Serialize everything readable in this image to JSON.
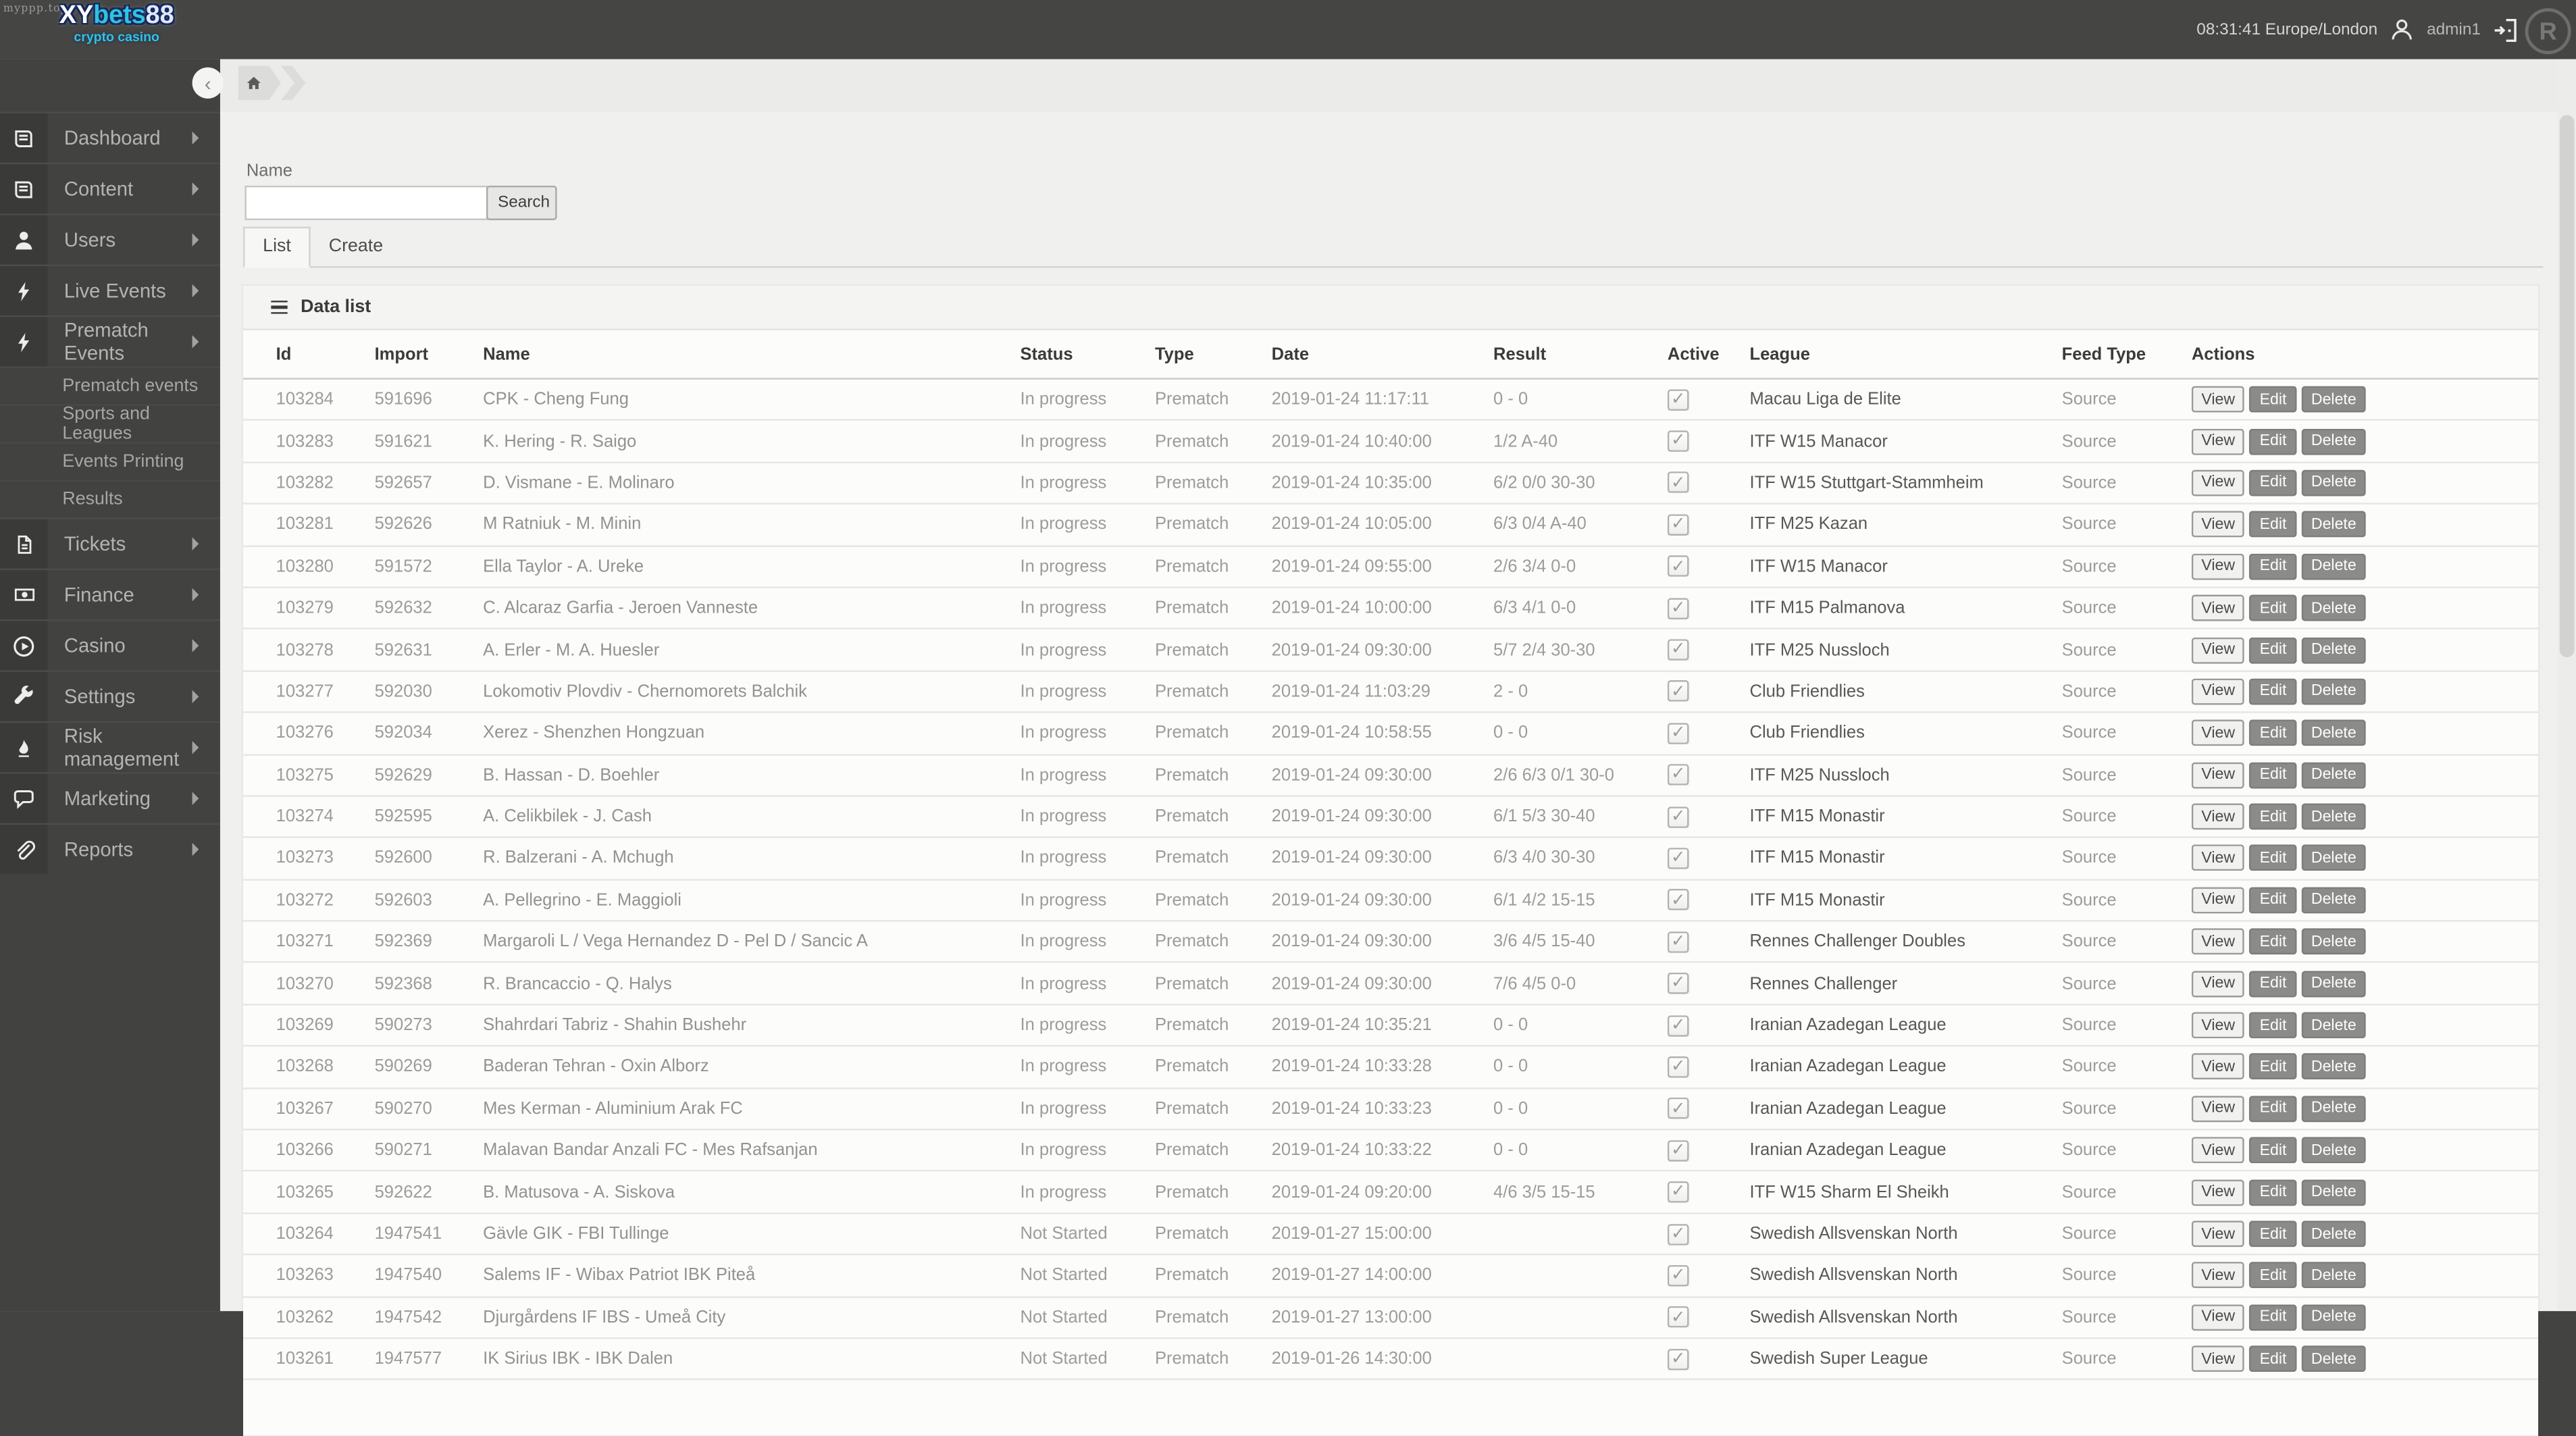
{
  "watermark": {
    "text": "myppp.top"
  },
  "brand": {
    "xy": "XY",
    "bets": "bets",
    "n88": "88",
    "subtitle": "crypto casino"
  },
  "topbar": {
    "clock": "08:31:41 Europe/London",
    "username": "admin1",
    "corner_badge": "R"
  },
  "colors": {
    "brand_cyan": "#2fc3e4",
    "sidebar_bg": "#424240",
    "topbar_bg": "#454543",
    "content_bg": "#f0f0ee",
    "button_dark": "#8b8b89",
    "accent_text": "#9c9c9a"
  },
  "sidebar": {
    "items": [
      {
        "type": "main",
        "icon": "book-icon",
        "label": "Dashboard"
      },
      {
        "type": "main",
        "icon": "book-icon",
        "label": "Content"
      },
      {
        "type": "main",
        "icon": "user-icon",
        "label": "Users"
      },
      {
        "type": "main",
        "icon": "bolt-icon",
        "label": "Live Events"
      },
      {
        "type": "main",
        "icon": "bolt-icon",
        "label": "Prematch Events"
      },
      {
        "type": "sub",
        "label": "Prematch events"
      },
      {
        "type": "sub",
        "label": "Sports and Leagues"
      },
      {
        "type": "sub",
        "label": "Events Printing"
      },
      {
        "type": "sub",
        "label": "Results"
      },
      {
        "type": "main",
        "icon": "file-icon",
        "label": "Tickets"
      },
      {
        "type": "main",
        "icon": "money-icon",
        "label": "Finance"
      },
      {
        "type": "main",
        "icon": "play-icon",
        "label": "Casino"
      },
      {
        "type": "main",
        "icon": "wrench-icon",
        "label": "Settings"
      },
      {
        "type": "main",
        "icon": "flame-icon",
        "label": "Risk management"
      },
      {
        "type": "main",
        "icon": "chat-icon",
        "label": "Marketing"
      },
      {
        "type": "main",
        "icon": "clip-icon",
        "label": "Reports"
      }
    ]
  },
  "filters": {
    "name_label": "Name",
    "name_value": "",
    "search_label": "Search"
  },
  "tabs": {
    "list": "List",
    "create": "Create"
  },
  "panel": {
    "title": "Data list"
  },
  "table": {
    "columns": [
      "Id",
      "Import",
      "Name",
      "Status",
      "Type",
      "Date",
      "Result",
      "Active",
      "League",
      "Feed Type",
      "Actions"
    ],
    "actions": [
      "View",
      "Edit",
      "Delete"
    ],
    "check_glyph": "✓",
    "rows": [
      {
        "id": "103284",
        "import": "591696",
        "name": "CPK - Cheng Fung",
        "status": "In progress",
        "type": "Prematch",
        "date": "2019-01-24 11:17:11",
        "result": "0 - 0",
        "active": true,
        "league": "Macau Liga de Elite",
        "feed": "Source"
      },
      {
        "id": "103283",
        "import": "591621",
        "name": "K. Hering - R. Saigo",
        "status": "In progress",
        "type": "Prematch",
        "date": "2019-01-24 10:40:00",
        "result": "1/2 A-40",
        "active": true,
        "league": "ITF W15 Manacor",
        "feed": "Source"
      },
      {
        "id": "103282",
        "import": "592657",
        "name": "D. Vismane - E. Molinaro",
        "status": "In progress",
        "type": "Prematch",
        "date": "2019-01-24 10:35:00",
        "result": "6/2 0/0 30-30",
        "active": true,
        "league": "ITF W15 Stuttgart-Stammheim",
        "feed": "Source"
      },
      {
        "id": "103281",
        "import": "592626",
        "name": "M Ratniuk - M. Minin",
        "status": "In progress",
        "type": "Prematch",
        "date": "2019-01-24 10:05:00",
        "result": "6/3 0/4 A-40",
        "active": true,
        "league": "ITF M25 Kazan",
        "feed": "Source"
      },
      {
        "id": "103280",
        "import": "591572",
        "name": "Ella Taylor - A. Ureke",
        "status": "In progress",
        "type": "Prematch",
        "date": "2019-01-24 09:55:00",
        "result": "2/6 3/4 0-0",
        "active": true,
        "league": "ITF W15 Manacor",
        "feed": "Source"
      },
      {
        "id": "103279",
        "import": "592632",
        "name": "C. Alcaraz Garfia - Jeroen Vanneste",
        "status": "In progress",
        "type": "Prematch",
        "date": "2019-01-24 10:00:00",
        "result": "6/3 4/1 0-0",
        "active": true,
        "league": "ITF M15 Palmanova",
        "feed": "Source"
      },
      {
        "id": "103278",
        "import": "592631",
        "name": "A. Erler - M. A. Huesler",
        "status": "In progress",
        "type": "Prematch",
        "date": "2019-01-24 09:30:00",
        "result": "5/7 2/4 30-30",
        "active": true,
        "league": "ITF M25 Nussloch",
        "feed": "Source"
      },
      {
        "id": "103277",
        "import": "592030",
        "name": "Lokomotiv Plovdiv - Chernomorets Balchik",
        "status": "In progress",
        "type": "Prematch",
        "date": "2019-01-24 11:03:29",
        "result": "2 - 0",
        "active": true,
        "league": "Club Friendlies",
        "feed": "Source"
      },
      {
        "id": "103276",
        "import": "592034",
        "name": "Xerez - Shenzhen Hongzuan",
        "status": "In progress",
        "type": "Prematch",
        "date": "2019-01-24 10:58:55",
        "result": "0 - 0",
        "active": true,
        "league": "Club Friendlies",
        "feed": "Source"
      },
      {
        "id": "103275",
        "import": "592629",
        "name": "B. Hassan - D. Boehler",
        "status": "In progress",
        "type": "Prematch",
        "date": "2019-01-24 09:30:00",
        "result": "2/6 6/3 0/1 30-0",
        "active": true,
        "league": "ITF M25 Nussloch",
        "feed": "Source"
      },
      {
        "id": "103274",
        "import": "592595",
        "name": "A. Celikbilek - J. Cash",
        "status": "In progress",
        "type": "Prematch",
        "date": "2019-01-24 09:30:00",
        "result": "6/1 5/3 30-40",
        "active": true,
        "league": "ITF M15 Monastir",
        "feed": "Source"
      },
      {
        "id": "103273",
        "import": "592600",
        "name": "R. Balzerani - A. Mchugh",
        "status": "In progress",
        "type": "Prematch",
        "date": "2019-01-24 09:30:00",
        "result": "6/3 4/0 30-30",
        "active": true,
        "league": "ITF M15 Monastir",
        "feed": "Source"
      },
      {
        "id": "103272",
        "import": "592603",
        "name": "A. Pellegrino - E. Maggioli",
        "status": "In progress",
        "type": "Prematch",
        "date": "2019-01-24 09:30:00",
        "result": "6/1 4/2 15-15",
        "active": true,
        "league": "ITF M15 Monastir",
        "feed": "Source"
      },
      {
        "id": "103271",
        "import": "592369",
        "name": "Margaroli L / Vega Hernandez D - Pel D / Sancic A",
        "status": "In progress",
        "type": "Prematch",
        "date": "2019-01-24 09:30:00",
        "result": "3/6 4/5 15-40",
        "active": true,
        "league": "Rennes Challenger Doubles",
        "feed": "Source"
      },
      {
        "id": "103270",
        "import": "592368",
        "name": "R. Brancaccio - Q. Halys",
        "status": "In progress",
        "type": "Prematch",
        "date": "2019-01-24 09:30:00",
        "result": "7/6 4/5 0-0",
        "active": true,
        "league": "Rennes Challenger",
        "feed": "Source"
      },
      {
        "id": "103269",
        "import": "590273",
        "name": "Shahrdari Tabriz - Shahin Bushehr",
        "status": "In progress",
        "type": "Prematch",
        "date": "2019-01-24 10:35:21",
        "result": "0 - 0",
        "active": true,
        "league": "Iranian Azadegan League",
        "feed": "Source"
      },
      {
        "id": "103268",
        "import": "590269",
        "name": "Baderan Tehran - Oxin Alborz",
        "status": "In progress",
        "type": "Prematch",
        "date": "2019-01-24 10:33:28",
        "result": "0 - 0",
        "active": true,
        "league": "Iranian Azadegan League",
        "feed": "Source"
      },
      {
        "id": "103267",
        "import": "590270",
        "name": "Mes Kerman - Aluminium Arak FC",
        "status": "In progress",
        "type": "Prematch",
        "date": "2019-01-24 10:33:23",
        "result": "0 - 0",
        "active": true,
        "league": "Iranian Azadegan League",
        "feed": "Source"
      },
      {
        "id": "103266",
        "import": "590271",
        "name": "Malavan Bandar Anzali FC - Mes Rafsanjan",
        "status": "In progress",
        "type": "Prematch",
        "date": "2019-01-24 10:33:22",
        "result": "0 - 0",
        "active": true,
        "league": "Iranian Azadegan League",
        "feed": "Source"
      },
      {
        "id": "103265",
        "import": "592622",
        "name": "B. Matusova - A. Siskova",
        "status": "In progress",
        "type": "Prematch",
        "date": "2019-01-24 09:20:00",
        "result": "4/6 3/5 15-15",
        "active": true,
        "league": "ITF W15 Sharm El Sheikh",
        "feed": "Source"
      },
      {
        "id": "103264",
        "import": "1947541",
        "name": "Gävle GIK - FBI Tullinge",
        "status": "Not Started",
        "type": "Prematch",
        "date": "2019-01-27 15:00:00",
        "result": "",
        "active": true,
        "league": "Swedish Allsvenskan North",
        "feed": "Source"
      },
      {
        "id": "103263",
        "import": "1947540",
        "name": "Salems IF - Wibax Patriot IBK Piteå",
        "status": "Not Started",
        "type": "Prematch",
        "date": "2019-01-27 14:00:00",
        "result": "",
        "active": true,
        "league": "Swedish Allsvenskan North",
        "feed": "Source"
      },
      {
        "id": "103262",
        "import": "1947542",
        "name": "Djurgårdens IF IBS - Umeå City",
        "status": "Not Started",
        "type": "Prematch",
        "date": "2019-01-27 13:00:00",
        "result": "",
        "active": true,
        "league": "Swedish Allsvenskan North",
        "feed": "Source"
      },
      {
        "id": "103261",
        "import": "1947577",
        "name": "IK Sirius IBK - IBK Dalen",
        "status": "Not Started",
        "type": "Prematch",
        "date": "2019-01-26 14:30:00",
        "result": "",
        "active": true,
        "league": "Swedish Super League",
        "feed": "Source"
      }
    ]
  }
}
